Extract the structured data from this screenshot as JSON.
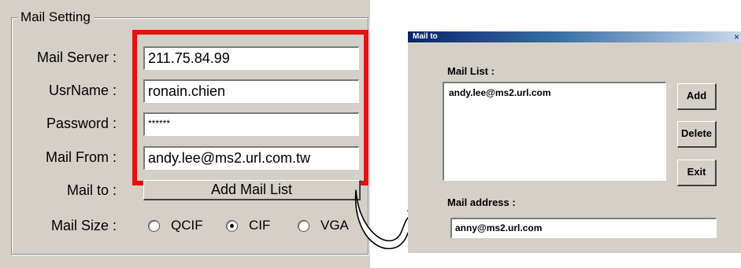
{
  "mail_setting": {
    "group_title": "Mail Setting",
    "fields": [
      {
        "label": "Mail Server :",
        "value": "211.75.84.99"
      },
      {
        "label": "UsrName :",
        "value": "ronain.chien"
      },
      {
        "label": "Password :",
        "value": "******"
      },
      {
        "label": "Mail From :",
        "value": "andy.lee@ms2.url.com.tw"
      }
    ],
    "mail_to_label": "Mail to :",
    "add_mail_list_label": "Add Mail List",
    "mail_size_label": "Mail Size :",
    "size_options": [
      {
        "label": "QCIF",
        "selected": false
      },
      {
        "label": "CIF",
        "selected": true
      },
      {
        "label": "VGA",
        "selected": false
      }
    ],
    "highlight_color": "#e51010"
  },
  "dialog": {
    "title": "Mail to",
    "close_glyph": "×",
    "mail_list_label": "Mail List :",
    "mail_list_items": [
      "andy.lee@ms2.url.com"
    ],
    "buttons": {
      "add": "Add",
      "delete": "Delete",
      "exit": "Exit"
    },
    "mail_address_label": "Mail address :",
    "mail_address_value": "anny@ms2.url.com"
  }
}
